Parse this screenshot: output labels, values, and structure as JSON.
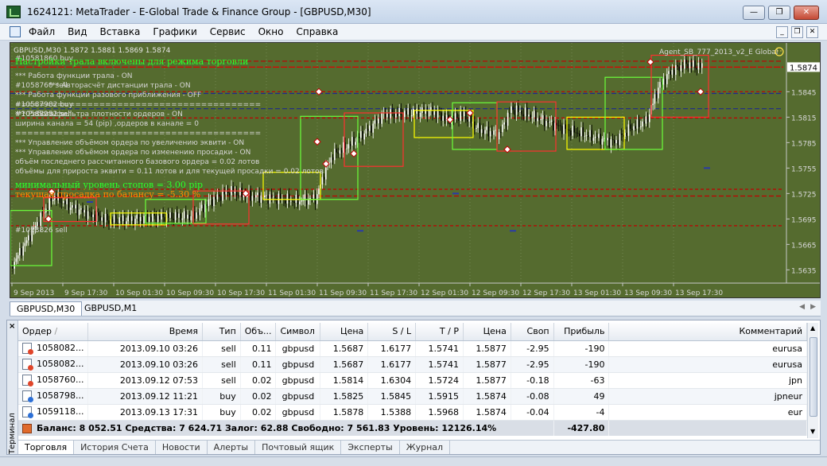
{
  "window": {
    "title": "1624121: MetaTrader - E-Global Trade & Finance Group - [GBPUSD,M30]",
    "minimize": "—",
    "maximize": "❐",
    "close": "✕"
  },
  "menu": {
    "items": [
      "Файл",
      "Вид",
      "Вставка",
      "Графики",
      "Сервис",
      "Окно",
      "Справка"
    ],
    "mdi_minimize": "_",
    "mdi_restore": "❐",
    "mdi_close": "✕"
  },
  "chart": {
    "header": "GBPUSD,M30  1.5872 1.5881 1.5869 1.5874",
    "expert": "Agent_SB_777_2013_v2_E Global",
    "current_price": "1.5874",
    "price_labels": [
      "1.5874",
      "1.5845",
      "1.5815",
      "1.5785",
      "1.5755",
      "1.5725",
      "1.5695",
      "1.5665",
      "1.5635"
    ],
    "time_labels": [
      "9 Sep 2013",
      "9 Sep 17:30",
      "10 Sep 01:30",
      "10 Sep 09:30",
      "10 Sep 17:30",
      "11 Sep 01:30",
      "11 Sep 09:30",
      "11 Sep 17:30",
      "12 Sep 01:30",
      "12 Sep 09:30",
      "12 Sep 17:30",
      "13 Sep 01:30",
      "13 Sep 09:30",
      "13 Sep 17:30"
    ],
    "overlay_lines": [
      "#10581860 buy",
      "Настройки трала включены для режима  торговли",
      "*** Работа функции трала -   ON",
      "#1058760 sell",
      "*** Авторасчёт дистанции трала -   ON",
      "#10587982 buy",
      "*** Работа функции разового приближения -   OFF",
      "#10587982 sell",
      "=========================================",
      "#10588251 sell",
      "*** Работа фильтра плотности ордеров -   ON",
      "ширина канала = 54 (pip) ,ордеров в канале =  0",
      "=========================================",
      "*** Управление объёмом ордера по увеличению эквити -   ON",
      "*** Управление объёмом ордера по изменению просадки -   ON",
      "объём последнего рассчитанного базового ордера =  0.02 лотов",
      "объёмы для прироста эквити = 0.11 лотов и для текущей просадки = 0.02 лотов",
      "минимальный уровень стопов =  3.00 pip",
      "текущая просадка по балансу =  -5.30 %",
      "#1058826 sell"
    ],
    "colors": {
      "background": "#556b2f",
      "up": "#ffffff",
      "down": "#000000",
      "accent_red": "#e00000",
      "box_green": "#6cff3c",
      "box_yellow": "#ffff00",
      "box_red": "#ff3030"
    }
  },
  "symbol_tabs": [
    "GBPUSD,M30",
    "GBPUSD,M1"
  ],
  "terminal": {
    "side_label": "Терминал",
    "close": "×",
    "columns": [
      "Ордер",
      "Время",
      "Тип",
      "Объ...",
      "Символ",
      "Цена",
      "S / L",
      "T / P",
      "Цена",
      "Своп",
      "Прибыль",
      "Комментарий"
    ],
    "sort_marker": "/",
    "orders": [
      {
        "order": "1058082...",
        "time": "2013.09.10 03:26",
        "type": "sell",
        "volume": "0.11",
        "symbol": "gbpusd",
        "price": "1.5687",
        "sl": "1.6177",
        "tp": "1.5741",
        "cur": "1.5877",
        "swap": "-2.95",
        "profit": "-190",
        "comment": "eurusa"
      },
      {
        "order": "1058082...",
        "time": "2013.09.10 03:26",
        "type": "sell",
        "volume": "0.11",
        "symbol": "gbpusd",
        "price": "1.5687",
        "sl": "1.6177",
        "tp": "1.5741",
        "cur": "1.5877",
        "swap": "-2.95",
        "profit": "-190",
        "comment": "eurusa"
      },
      {
        "order": "1058760...",
        "time": "2013.09.12 07:53",
        "type": "sell",
        "volume": "0.02",
        "symbol": "gbpusd",
        "price": "1.5814",
        "sl": "1.6304",
        "tp": "1.5724",
        "cur": "1.5877",
        "swap": "-0.18",
        "profit": "-63",
        "comment": "jpn"
      },
      {
        "order": "1058798...",
        "time": "2013.09.12 11:21",
        "type": "buy",
        "volume": "0.02",
        "symbol": "gbpusd",
        "price": "1.5825",
        "sl": "1.5845",
        "tp": "1.5915",
        "cur": "1.5874",
        "swap": "-0.08",
        "profit": "49",
        "comment": "jpneur"
      },
      {
        "order": "1059118...",
        "time": "2013.09.13 17:31",
        "type": "buy",
        "volume": "0.02",
        "symbol": "gbpusd",
        "price": "1.5878",
        "sl": "1.5388",
        "tp": "1.5968",
        "cur": "1.5874",
        "swap": "-0.04",
        "profit": "-4",
        "comment": "eur"
      }
    ],
    "summary": "Баланс: 8 052.51  Средства: 7 624.71  Залог: 62.88  Свободно: 7 561.83  Уровень: 12126.14%",
    "summary_profit": "-427.80",
    "tabs": [
      "Торговля",
      "История Счета",
      "Новости",
      "Алерты",
      "Почтовый ящик",
      "Эксперты",
      "Журнал"
    ]
  }
}
